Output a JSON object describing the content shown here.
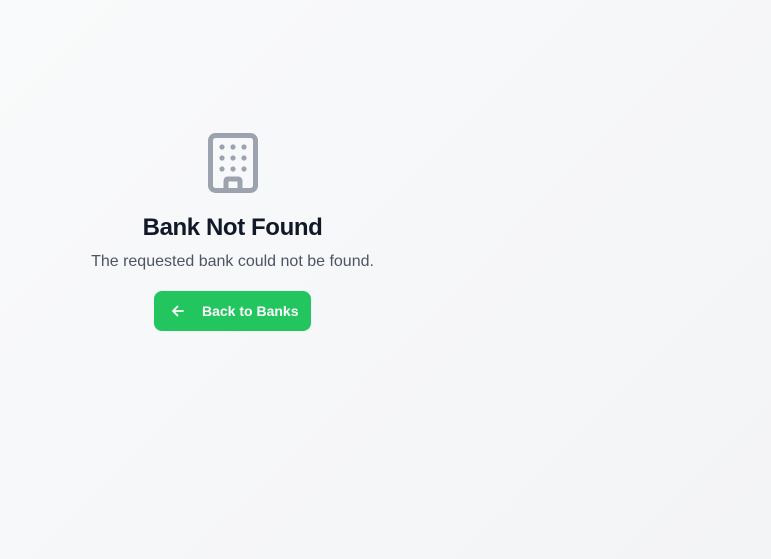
{
  "error": {
    "icon": "building-icon",
    "title": "Bank Not Found",
    "message": "The requested bank could not be found."
  },
  "actions": {
    "back_icon": "arrow-left-icon",
    "back_label": "Back to Banks"
  },
  "colors": {
    "accent": "#22c55e",
    "title": "#111827",
    "message": "#4b5563",
    "icon": "#9ca3af",
    "background": "#f3f4f6"
  }
}
